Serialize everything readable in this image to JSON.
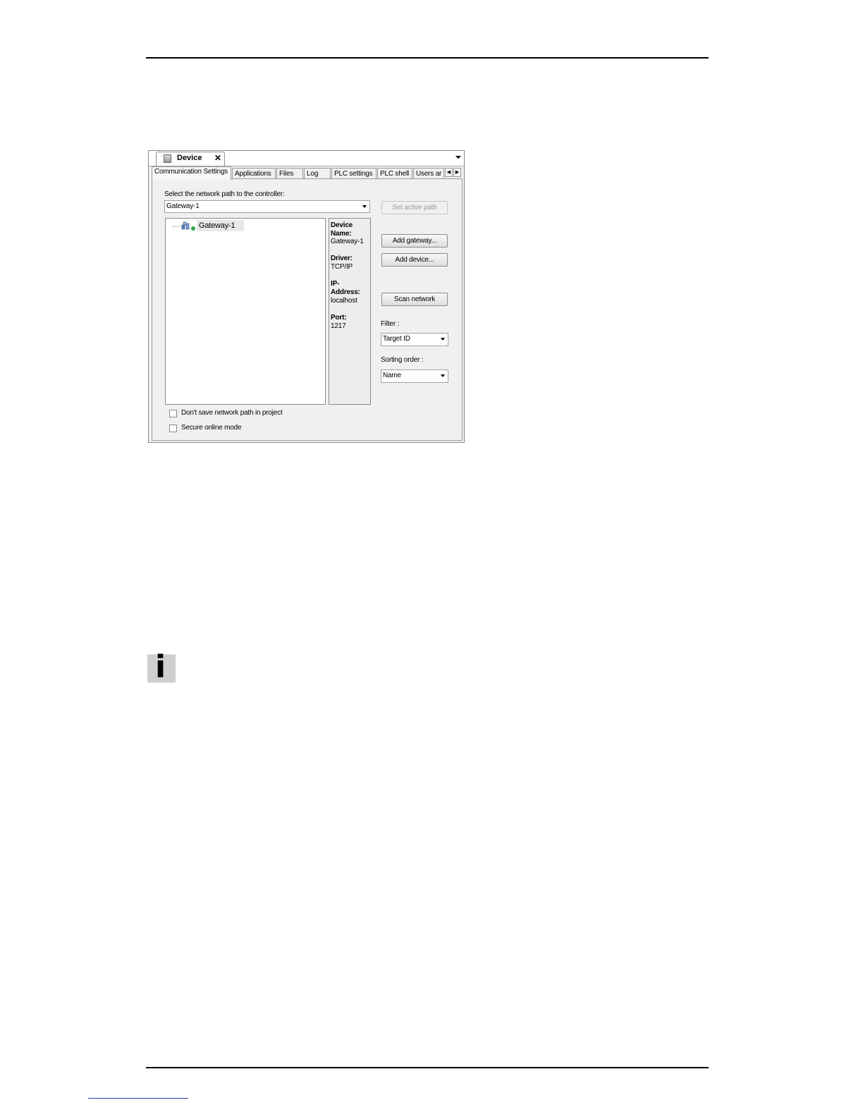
{
  "window": {
    "tab_title": "Device",
    "close_glyph": "✕",
    "tabs": [
      "Communication Settings",
      "Applications",
      "Files",
      "Log",
      "PLC settings",
      "PLC shell",
      "Users ar"
    ],
    "active_tab": 0
  },
  "comm": {
    "path_label": "Select the network path to the controller:",
    "path_value": "Gateway-1",
    "tree_node": "Gateway-1",
    "info": {
      "device_name_key": "Device Name:",
      "device_name_val": "Gateway-1",
      "driver_key": "Driver:",
      "driver_val": "TCP/IP",
      "ip_key": "IP-Address:",
      "ip_val": "localhost",
      "port_key": "Port:",
      "port_val": "1217"
    },
    "buttons": {
      "set_active_path": "Set active path",
      "add_gateway": "Add gateway...",
      "add_device": "Add device...",
      "scan_network": "Scan network"
    },
    "filter_label": "Filter :",
    "filter_value": "Target ID",
    "sorting_label": "Sorting order :",
    "sorting_value": "Name",
    "checkbox_dont_save": "Don't save network path in project",
    "checkbox_secure": "Secure online mode"
  },
  "note_icon": "info-icon"
}
